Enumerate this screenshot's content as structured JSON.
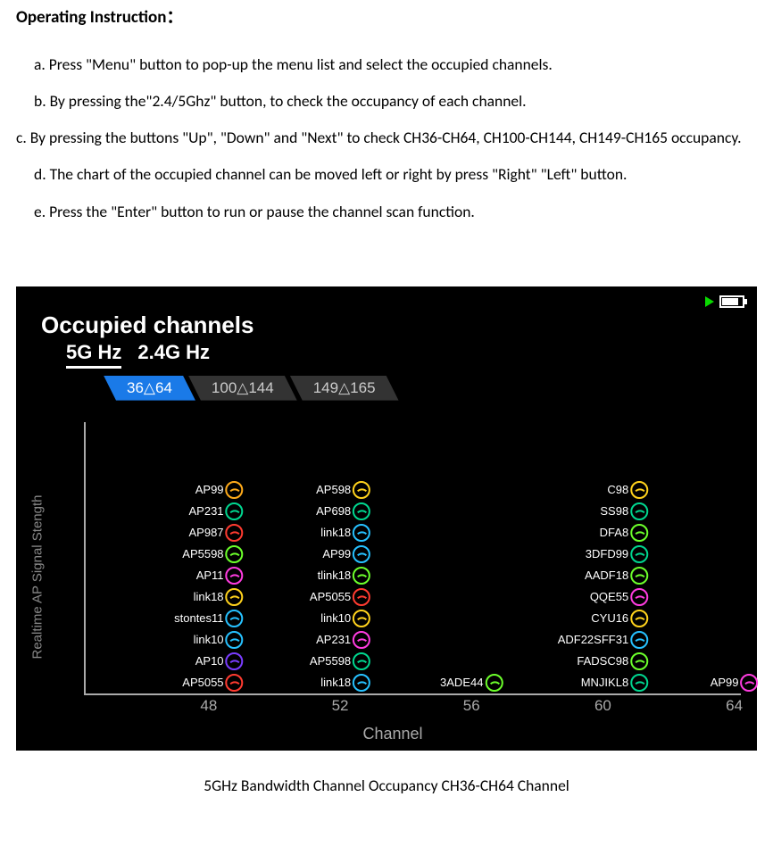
{
  "section_title": "Operating Instruction：",
  "instructions": {
    "a": "a. Press \"Menu\" button to pop-up the menu list and select the occupied channels.",
    "b": "b. By pressing the\"2.4/5Ghz\" button, to check the occupancy of each channel.",
    "c": "c. By pressing the buttons \"Up\", \"Down\" and \"Next\" to check CH36-CH64, CH100-CH144, CH149-CH165 occupancy.",
    "d": "d. The chart of the occupied channel can be moved left or right by press \"Right\" \"Left\" button.",
    "e": "e. Press the \"Enter\" button to run or pause the channel scan function."
  },
  "screenshot": {
    "title": "Occupied channels",
    "band_tabs": {
      "active": "5G Hz",
      "inactive": "2.4G Hz"
    },
    "range_tabs": {
      "active": "36△64",
      "r2": "100△144",
      "r3": "149△165"
    },
    "y_label": "Realtime AP Signal Stength",
    "x_label": "Channel",
    "x_ticks": {
      "t48": "48",
      "t52": "52",
      "t56": "56",
      "t60": "60",
      "t64": "64"
    }
  },
  "chart_data": {
    "type": "bar",
    "title": "Occupied channels",
    "xlabel": "Channel",
    "ylabel": "Realtime AP Signal Stength",
    "x_ticks": [
      48,
      52,
      56,
      60,
      64
    ],
    "stacks": [
      {
        "channel": 48,
        "aps": [
          {
            "name": "AP5055",
            "color": "#ff3b30"
          },
          {
            "name": "AP10",
            "color": "#7a3cff"
          },
          {
            "name": "link10",
            "color": "#26c1ff"
          },
          {
            "name": "stontes11",
            "color": "#26c1ff"
          },
          {
            "name": "link18",
            "color": "#ffd21c"
          },
          {
            "name": "AP11",
            "color": "#ff3ce0"
          },
          {
            "name": "AP5598",
            "color": "#6cff2b"
          },
          {
            "name": "AP987",
            "color": "#ff3b30"
          },
          {
            "name": "AP231",
            "color": "#00d68f"
          },
          {
            "name": "AP99",
            "color": "#ffab1a"
          }
        ]
      },
      {
        "channel": 52,
        "aps": [
          {
            "name": "link18",
            "color": "#26c1ff"
          },
          {
            "name": "AP5598",
            "color": "#00d68f"
          },
          {
            "name": "AP231",
            "color": "#ff3ce0"
          },
          {
            "name": "link10",
            "color": "#ffd21c"
          },
          {
            "name": "AP5055",
            "color": "#ff3b30"
          },
          {
            "name": "tlink18",
            "color": "#6cff2b"
          },
          {
            "name": "AP99",
            "color": "#26c1ff"
          },
          {
            "name": "link18",
            "color": "#26c1ff"
          },
          {
            "name": "AP698",
            "color": "#00d68f"
          },
          {
            "name": "AP598",
            "color": "#ffd21c"
          }
        ]
      },
      {
        "channel": 56,
        "aps": [
          {
            "name": "3ADE44",
            "color": "#6cff2b"
          }
        ]
      },
      {
        "channel": 60,
        "aps": [
          {
            "name": "MNJIKL8",
            "color": "#00d68f"
          },
          {
            "name": "FADSC98",
            "color": "#6cff2b"
          },
          {
            "name": "ADF22SFF31",
            "color": "#26c1ff"
          },
          {
            "name": "CYU16",
            "color": "#ffd21c"
          },
          {
            "name": "QQE55",
            "color": "#ff3ce0"
          },
          {
            "name": "AADF18",
            "color": "#6cff2b"
          },
          {
            "name": "3DFD99",
            "color": "#00d68f"
          },
          {
            "name": "DFA8",
            "color": "#6cff2b"
          },
          {
            "name": "SS98",
            "color": "#00d68f"
          },
          {
            "name": "C98",
            "color": "#ffd21c"
          }
        ]
      },
      {
        "channel": 64,
        "aps": [
          {
            "name": "AP99",
            "color": "#ff3ce0"
          }
        ]
      }
    ]
  },
  "caption": "5GHz Bandwidth Channel Occupancy CH36-CH64 Channel"
}
